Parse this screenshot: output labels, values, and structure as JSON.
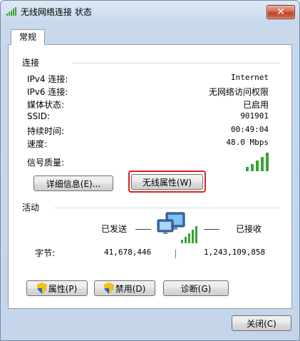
{
  "window": {
    "title": "无线网络连接 状态",
    "close_label": "✕"
  },
  "tabs": [
    {
      "label": "常规",
      "selected": true
    }
  ],
  "connection": {
    "section_title": "连接",
    "rows": [
      {
        "label": "IPv4 连接:",
        "value": "Internet"
      },
      {
        "label": "IPv6 连接:",
        "value": "无网络访问权限"
      },
      {
        "label": "媒体状态:",
        "value": "已启用"
      },
      {
        "label": "SSID:",
        "value": "901901"
      },
      {
        "label": "持续时间:",
        "value": "00:49:04"
      },
      {
        "label": "速度:",
        "value": "48.0 Mbps"
      }
    ],
    "signal_label": "信号质量:",
    "signal_bars": 5,
    "details_button": "详细信息(E)...",
    "wireless_props_button": "无线属性(W)"
  },
  "activity": {
    "section_title": "活动",
    "sent_label": "已发送",
    "received_label": "已接收",
    "bytes_label": "字节:",
    "bytes_sent": "41,678,446",
    "bytes_received": "1,243,109,858"
  },
  "actions": {
    "properties_button": "属性(P)",
    "disable_button": "禁用(D)",
    "diagnose_button": "诊断(G)"
  },
  "footer": {
    "close_button": "关闭(C)"
  },
  "colors": {
    "highlight": "#e02020",
    "signal_green": "#3aa234",
    "close_red": "#c1432a"
  }
}
